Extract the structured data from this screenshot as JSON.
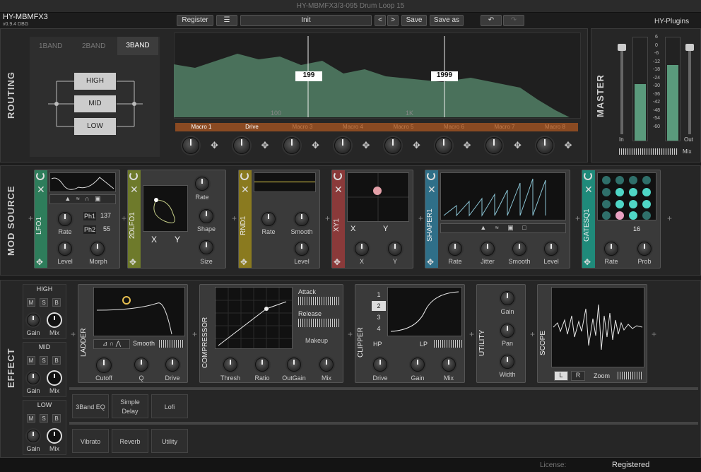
{
  "window_title": "HY-MBMFX3/3-095 Drum Loop 15",
  "app": {
    "name": "HY-MBMFX3",
    "version": "v0.9.4 DBG",
    "brand": "HY-Plugins"
  },
  "toolbar": {
    "register": "Register",
    "preset": "Init",
    "prev": "<",
    "next": ">",
    "save": "Save",
    "save_as": "Save as"
  },
  "routing": {
    "label": "ROUTING",
    "tabs": [
      "1BAND",
      "2BAND",
      "3BAND"
    ],
    "bands": [
      "HIGH",
      "MID",
      "LOW"
    ],
    "markers": [
      "199",
      "1999"
    ],
    "axis": [
      "100",
      "1K"
    ],
    "macros": [
      "Macro 1",
      "Drive",
      "Macro 3",
      "Macro 4",
      "Macro 5",
      "Macro 6",
      "Macro 7",
      "Macro 8"
    ]
  },
  "master": {
    "label": "MASTER",
    "scale": [
      "6",
      "0",
      "-6",
      "-12",
      "-18",
      "-24",
      "-30",
      "-36",
      "-42",
      "-48",
      "-54",
      "-60"
    ],
    "in": "In",
    "out": "Out",
    "mix": "Mix"
  },
  "mod": {
    "label": "MOD SOURCE",
    "lfo1": {
      "name": "LFO1",
      "rate": "Rate",
      "level": "Level",
      "morph": "Morph",
      "ph1": "Ph1",
      "ph1v": "137",
      "ph2": "Ph2",
      "ph2v": "55"
    },
    "dlfo": {
      "name": "2DLFO1",
      "rate": "Rate",
      "shape": "Shape",
      "size": "Size",
      "x": "X",
      "y": "Y"
    },
    "rnd": {
      "name": "RND1",
      "rate": "Rate",
      "smooth": "Smooth",
      "level": "Level"
    },
    "xy": {
      "name": "XY1",
      "x": "X",
      "y": "Y"
    },
    "shaper": {
      "name": "SHAPER1",
      "rate": "Rate",
      "jitter": "Jitter",
      "smooth": "Smooth",
      "level": "Level"
    },
    "gate": {
      "name": "GATESQ1",
      "rate": "Rate",
      "prob": "Prob",
      "steps": "16"
    }
  },
  "effect": {
    "label": "EFFECT",
    "bands": [
      {
        "name": "HIGH"
      },
      {
        "name": "MID"
      },
      {
        "name": "LOW"
      }
    ],
    "msb": [
      "M",
      "S",
      "B"
    ],
    "gain": "Gain",
    "mix": "Mix",
    "ladder": {
      "name": "LADDER",
      "smooth": "Smooth",
      "cutoff": "Cutoff",
      "q": "Q",
      "drive": "Drive"
    },
    "comp": {
      "name": "COMPRESSOR",
      "attack": "Attack",
      "release": "Release",
      "makeup": "Makeup",
      "thresh": "Thresh",
      "ratio": "Ratio",
      "outgain": "OutGain",
      "mix": "Mix"
    },
    "clipper": {
      "name": "CLIPPER",
      "modes": [
        "1",
        "2",
        "3",
        "4"
      ],
      "hp": "HP",
      "lp": "LP",
      "drive": "Drive",
      "gain": "Gain",
      "mix": "Mix"
    },
    "utility": {
      "name": "UTILITY",
      "gain": "Gain",
      "pan": "Pan",
      "width": "Width"
    },
    "scope": {
      "name": "SCOPE",
      "l": "L",
      "r": "R",
      "zoom": "Zoom"
    },
    "mid_chain": [
      "3Band EQ",
      "Simple Delay",
      "Lofi"
    ],
    "low_chain": [
      "Vibrato",
      "Reverb",
      "Utility"
    ]
  },
  "status": {
    "license": "License:",
    "registered": "Registered"
  }
}
